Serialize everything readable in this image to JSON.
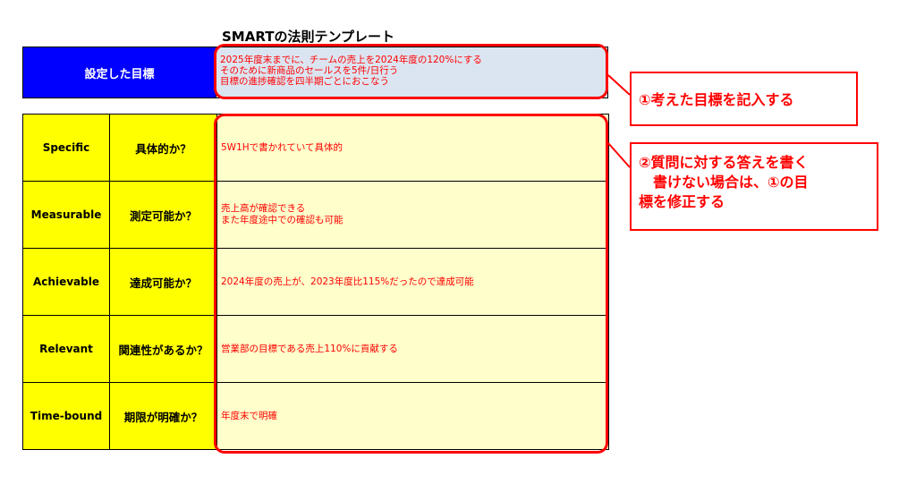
{
  "title": "SMARTの法則テンプレート",
  "goal": {
    "label": "設定した目標",
    "lines": [
      "2025年度末までに、チームの売上を2024年度の120%にする",
      "そのために新商品のセールスを5件/日行う",
      "目標の進捗確認を四半期ごとにおこなう"
    ]
  },
  "rows": [
    {
      "term": "Specific",
      "question": "具体的か？",
      "answer": [
        "5W1Hで書かれていて具体的"
      ]
    },
    {
      "term": "Measurable",
      "question": "測定可能か？",
      "answer": [
        "売上高が確認できる",
        "また年度途中での確認も可能"
      ]
    },
    {
      "term": "Achievable",
      "question": "達成可能か？",
      "answer": [
        "2024年度の売上が、2023年度比115%だったので達成可能"
      ]
    },
    {
      "term": "Relevant",
      "question": "関連性があるか？",
      "answer": [
        "営業部の目標である売上110%に貢献する"
      ]
    },
    {
      "term": "Time-bound",
      "question": "期限が明確か？",
      "answer": [
        "年度末で明確"
      ]
    }
  ],
  "callouts": {
    "one": "①考えた目標を記入する",
    "two": [
      "②質問に対する答えを書く",
      "　書けない場合は、①の目",
      "標を修正する"
    ]
  },
  "colors": {
    "goal_label_bg": "#0000ff",
    "goal_value_bg": "#dbe5f1",
    "term_bg": "#ffff00",
    "answer_bg": "#ffffcc",
    "accent": "#ff0000"
  }
}
